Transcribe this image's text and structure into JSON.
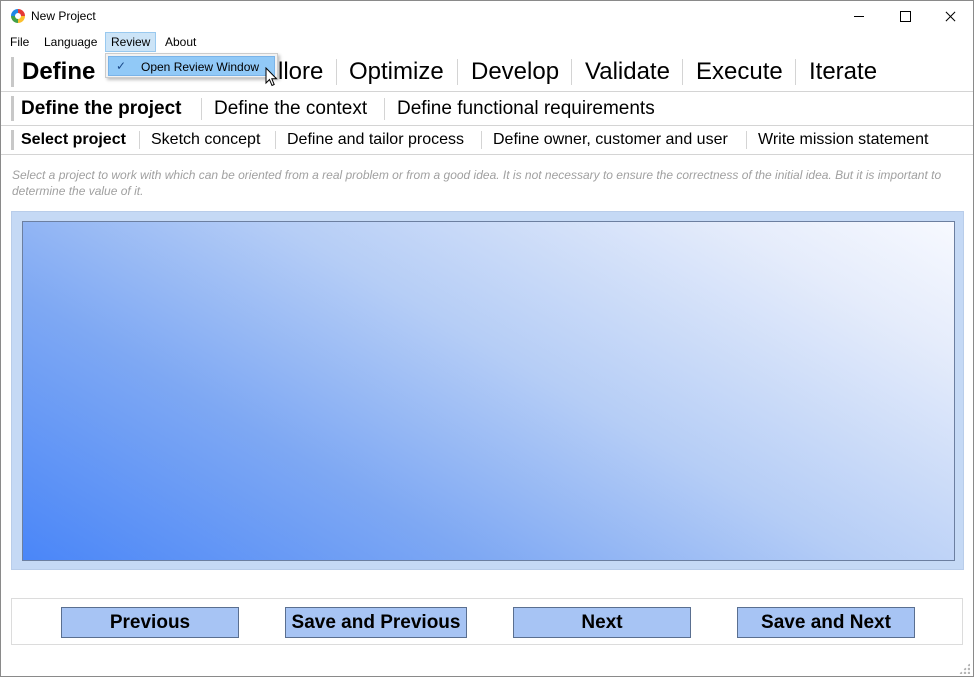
{
  "window": {
    "title": "New Project"
  },
  "menubar": {
    "items": [
      {
        "label": "File"
      },
      {
        "label": "Language"
      },
      {
        "label": "Review"
      },
      {
        "label": "About"
      }
    ],
    "open_menu": "Review"
  },
  "dropdown": {
    "items": [
      {
        "label": "Open Review Window",
        "checked": true
      }
    ]
  },
  "phase_tabs": {
    "items": [
      "Define",
      "Explore",
      "Optimize",
      "Develop",
      "Validate",
      "Execute",
      "Iterate"
    ],
    "visible_partial": [
      "Define",
      "llore",
      "Optimize",
      "Develop",
      "Validate",
      "Execute",
      "Iterate"
    ],
    "selected": "Define"
  },
  "step_tabs": {
    "items": [
      "Define the project",
      "Define the context",
      "Define functional requirements"
    ],
    "selected": "Define the project"
  },
  "task_tabs": {
    "items": [
      "Select project",
      "Sketch concept",
      "Define and tailor process",
      "Define owner, customer and user",
      "Write mission statement"
    ],
    "selected": "Select project"
  },
  "description": "Select a project to work with which can be oriented from a real problem or from a good idea. It is not necessary to ensure the correctness of the initial idea. But it is important to determine the value of it.",
  "buttons": {
    "previous": "Previous",
    "save_previous": "Save and Previous",
    "next": "Next",
    "save_next": "Save and Next"
  },
  "colors": {
    "button_fill": "#a7c4f4",
    "canvas_gradient_start": "#4a86f8",
    "canvas_gradient_end": "#f7f9ff",
    "menu_highlight": "#91c9f7"
  }
}
